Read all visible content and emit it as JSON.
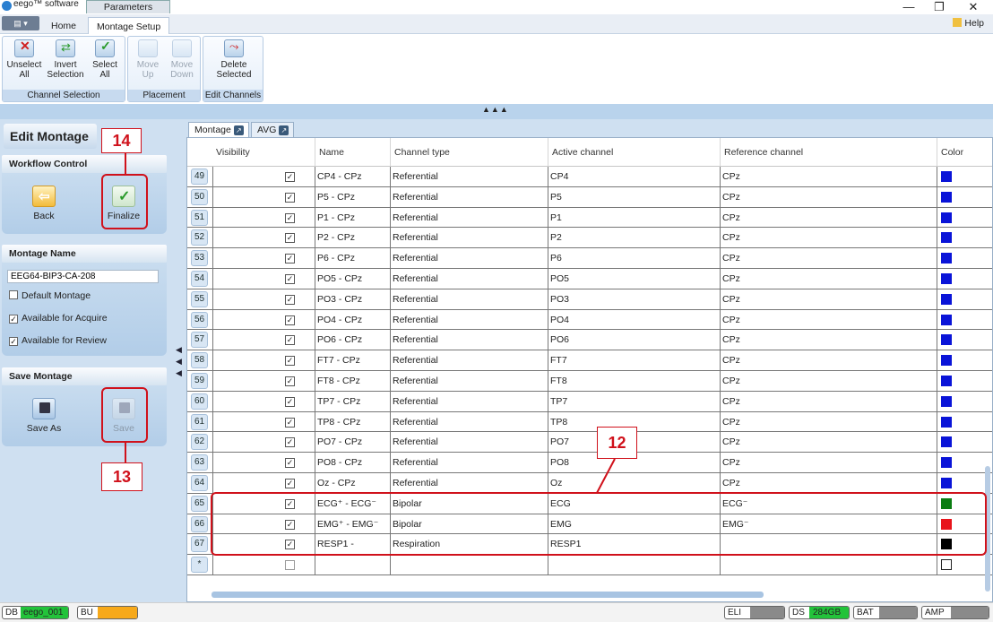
{
  "window": {
    "app_title": "eego™ software",
    "doc_tab": "Parameters",
    "minimize_glyph": "—",
    "restore_glyph": "❐",
    "close_glyph": "✕"
  },
  "ribbon_tabs": [
    {
      "label": "Home"
    },
    {
      "label": "Montage Setup"
    }
  ],
  "help_label": "Help",
  "ribbon_groups": {
    "channel_selection": {
      "label": "Channel Selection",
      "buttons": [
        "Unselect\nAll",
        "Invert\nSelection",
        "Select\nAll"
      ]
    },
    "placement": {
      "label": "Placement",
      "buttons": [
        "Move\nUp",
        "Move\nDown"
      ]
    },
    "edit_channels": {
      "label": "Edit Channels",
      "buttons": [
        "Delete\nSelected"
      ]
    }
  },
  "left": {
    "title": "Edit Montage",
    "workflow_header": "Workflow Control",
    "back_label": "Back",
    "finalize_label": "Finalize",
    "montage_name_header": "Montage Name",
    "montage_name_value": "EEG64-BIP3-CA-208",
    "options": [
      {
        "label": "Default Montage",
        "checked": false
      },
      {
        "label": "Available for Acquire",
        "checked": true
      },
      {
        "label": "Available for Review",
        "checked": true
      }
    ],
    "save_header": "Save Montage",
    "save_as_label": "Save As",
    "save_label": "Save"
  },
  "annotations": {
    "finalize": "14",
    "save": "13",
    "rows": "12"
  },
  "grid": {
    "tabs": [
      "Montage",
      "AVG"
    ],
    "columns": [
      "Visibility",
      "Name",
      "Channel type",
      "Active channel",
      "Reference channel",
      "Color"
    ],
    "rows": [
      {
        "num": "49",
        "name": "CP4 - CPz",
        "type": "Referential",
        "active": "CP4",
        "ref": "CPz",
        "color": "#0a14d8"
      },
      {
        "num": "50",
        "name": "P5 - CPz",
        "type": "Referential",
        "active": "P5",
        "ref": "CPz",
        "color": "#0a14d8"
      },
      {
        "num": "51",
        "name": "P1 - CPz",
        "type": "Referential",
        "active": "P1",
        "ref": "CPz",
        "color": "#0a14d8"
      },
      {
        "num": "52",
        "name": "P2 - CPz",
        "type": "Referential",
        "active": "P2",
        "ref": "CPz",
        "color": "#0a14d8"
      },
      {
        "num": "53",
        "name": "P6 - CPz",
        "type": "Referential",
        "active": "P6",
        "ref": "CPz",
        "color": "#0a14d8"
      },
      {
        "num": "54",
        "name": "PO5 - CPz",
        "type": "Referential",
        "active": "PO5",
        "ref": "CPz",
        "color": "#0a14d8"
      },
      {
        "num": "55",
        "name": "PO3 - CPz",
        "type": "Referential",
        "active": "PO3",
        "ref": "CPz",
        "color": "#0a14d8"
      },
      {
        "num": "56",
        "name": "PO4 - CPz",
        "type": "Referential",
        "active": "PO4",
        "ref": "CPz",
        "color": "#0a14d8"
      },
      {
        "num": "57",
        "name": "PO6 - CPz",
        "type": "Referential",
        "active": "PO6",
        "ref": "CPz",
        "color": "#0a14d8"
      },
      {
        "num": "58",
        "name": "FT7 - CPz",
        "type": "Referential",
        "active": "FT7",
        "ref": "CPz",
        "color": "#0a14d8"
      },
      {
        "num": "59",
        "name": "FT8 - CPz",
        "type": "Referential",
        "active": "FT8",
        "ref": "CPz",
        "color": "#0a14d8"
      },
      {
        "num": "60",
        "name": "TP7 - CPz",
        "type": "Referential",
        "active": "TP7",
        "ref": "CPz",
        "color": "#0a14d8"
      },
      {
        "num": "61",
        "name": "TP8 - CPz",
        "type": "Referential",
        "active": "TP8",
        "ref": "CPz",
        "color": "#0a14d8"
      },
      {
        "num": "62",
        "name": "PO7 - CPz",
        "type": "Referential",
        "active": "PO7",
        "ref": "CPz",
        "color": "#0a14d8"
      },
      {
        "num": "63",
        "name": "PO8 - CPz",
        "type": "Referential",
        "active": "PO8",
        "ref": "CPz",
        "color": "#0a14d8"
      },
      {
        "num": "64",
        "name": "Oz - CPz",
        "type": "Referential",
        "active": "Oz",
        "ref": "CPz",
        "color": "#0a14d8"
      },
      {
        "num": "65",
        "name": "ECG⁺ - ECG⁻",
        "type": "Bipolar",
        "active": "ECG",
        "ref": "ECG⁻",
        "color": "#0b7d12"
      },
      {
        "num": "66",
        "name": "EMG⁺ - EMG⁻",
        "type": "Bipolar",
        "active": "EMG",
        "ref": "EMG⁻",
        "color": "#e8141b"
      },
      {
        "num": "67",
        "name": "RESP1 -",
        "type": "Respiration",
        "active": "RESP1",
        "ref": "",
        "color": "#000000"
      },
      {
        "num": "*",
        "name": "",
        "type": "",
        "active": "",
        "ref": "",
        "color": ""
      }
    ]
  },
  "status": {
    "db_label": "DB",
    "db_value": "eego_001",
    "bu_label": "BU",
    "eli_label": "ELI",
    "ds_label": "DS",
    "ds_value": "284GB",
    "bat_label": "BAT",
    "amp_label": "AMP"
  },
  "colors": {
    "accent_red": "#d0111b",
    "status_green": "#22c33a",
    "status_orange": "#f7a91a"
  }
}
